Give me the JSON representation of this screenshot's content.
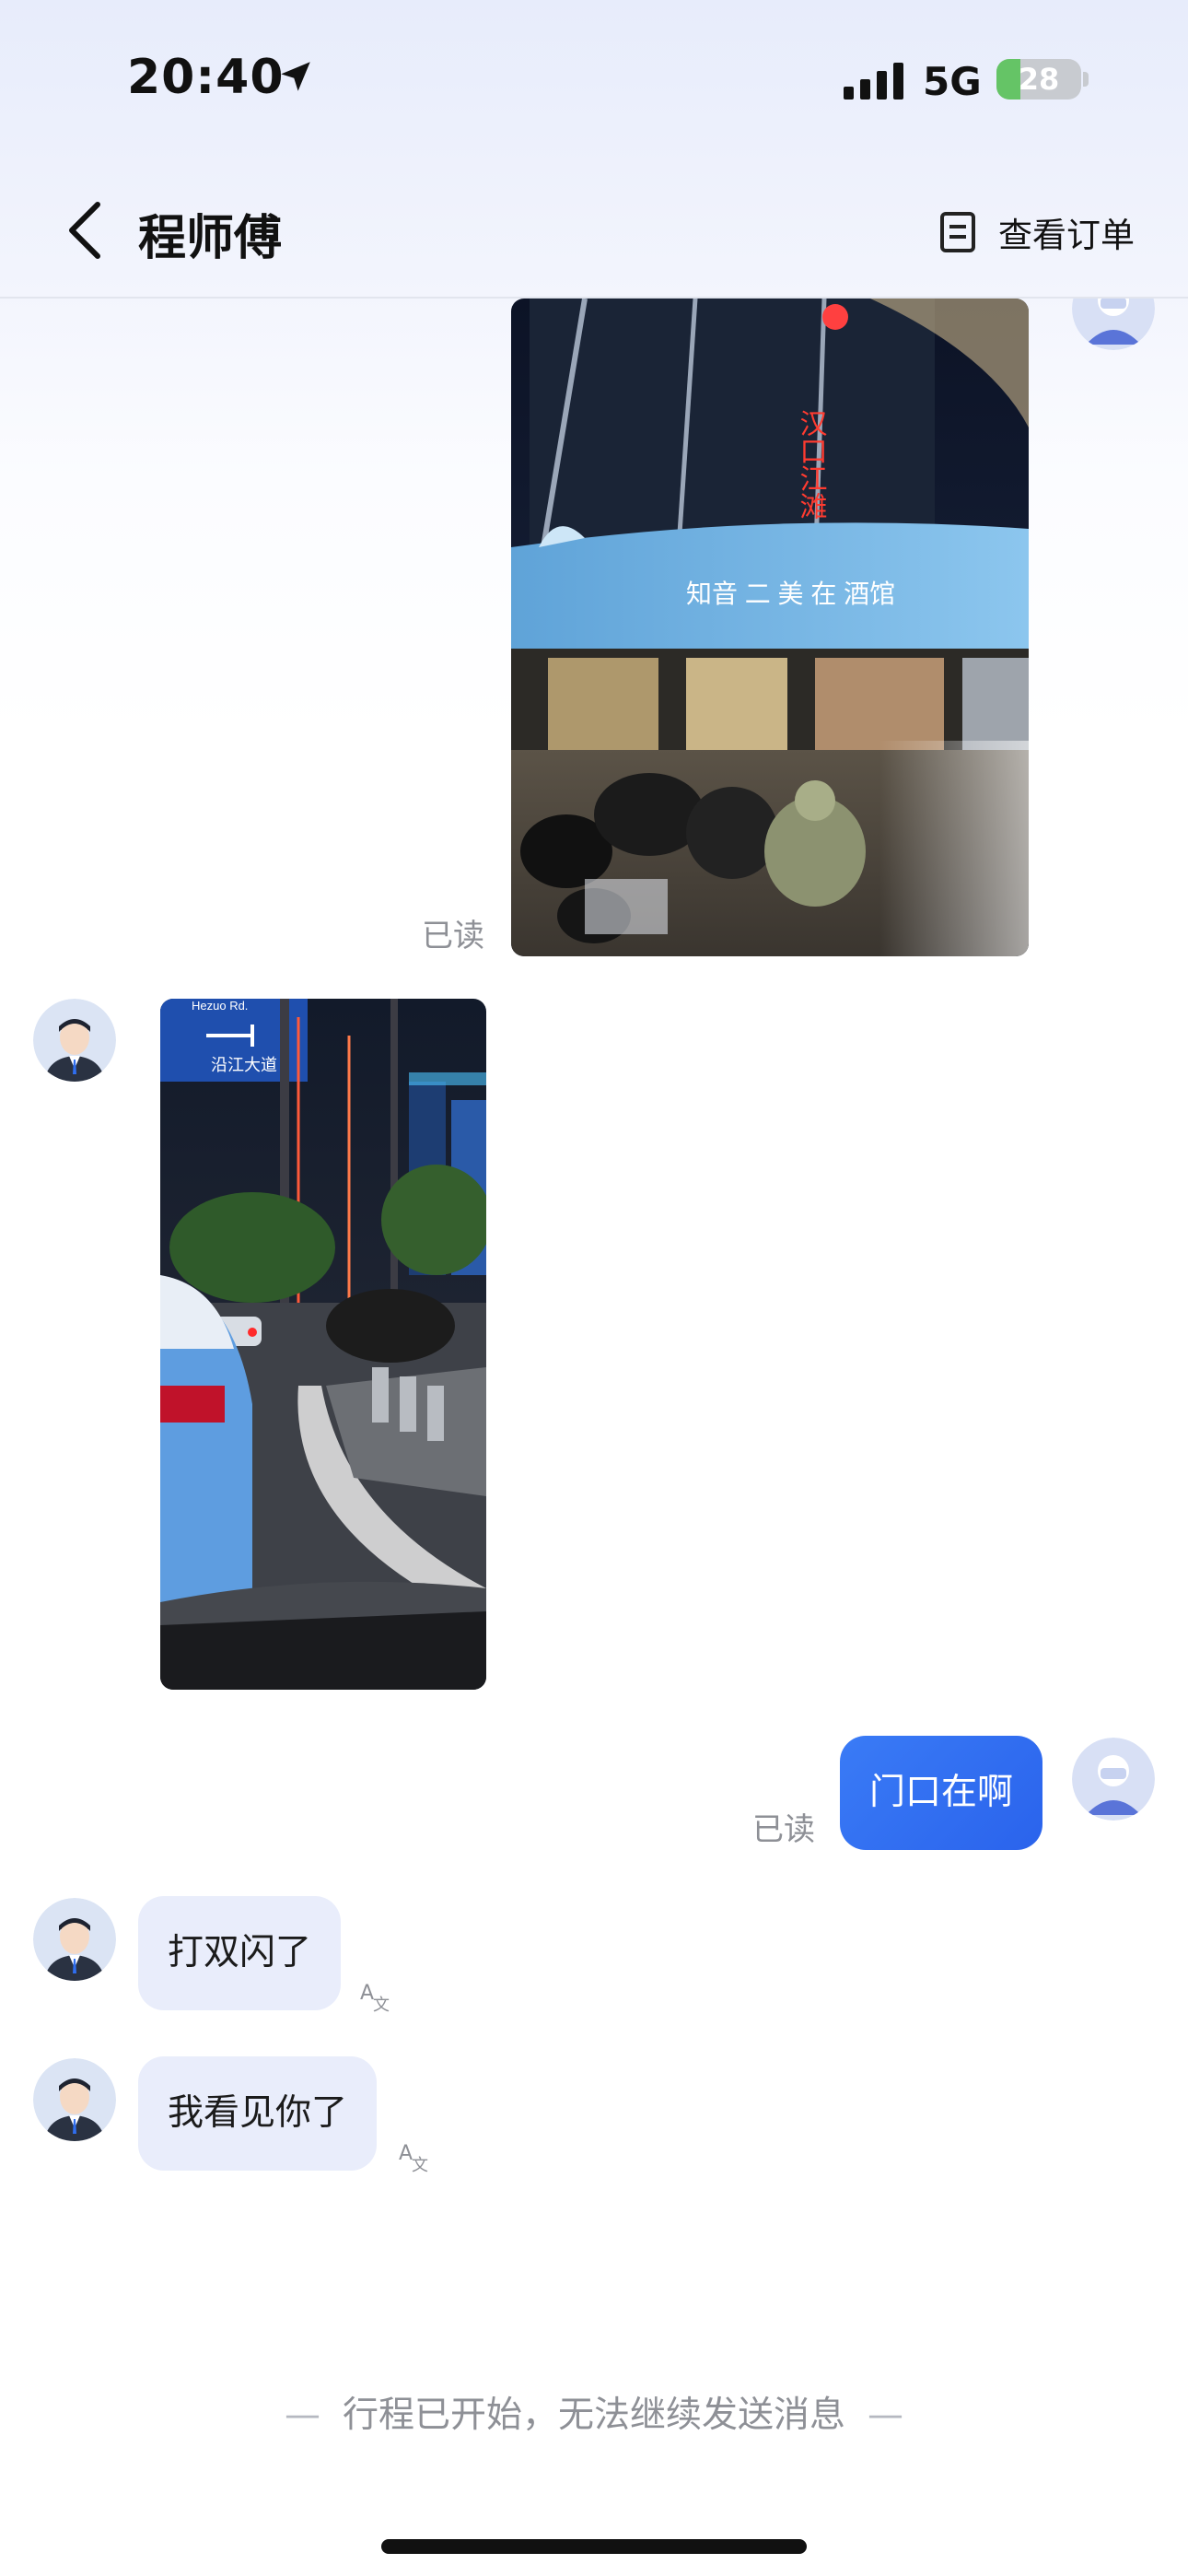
{
  "status_bar": {
    "time": "20:40",
    "network": "5G",
    "battery": "28",
    "battery_level": 0.28
  },
  "header": {
    "title": "程师傅",
    "order_label": "查看订单"
  },
  "messages": {
    "read_label_1": "已读",
    "read_label_2": "已读",
    "outgoing_text": "门口在啊",
    "incoming_1": "打双闪了",
    "incoming_2": "我看见你了",
    "photo_mall_sign_vertical": "汉口江滩",
    "photo_mall_sign": "知音 二 美 在 酒馆",
    "photo_road_sign_top": "Hezuo Rd.",
    "photo_road_sign": "沿江大道"
  },
  "footer": {
    "notice": "行程已开始，无法继续发送消息",
    "dash_left": "—",
    "dash_right": "—"
  },
  "colors": {
    "accent": "#2f6ef0",
    "incoming_bubble": "#e9edfb",
    "battery_green": "#65c466"
  }
}
